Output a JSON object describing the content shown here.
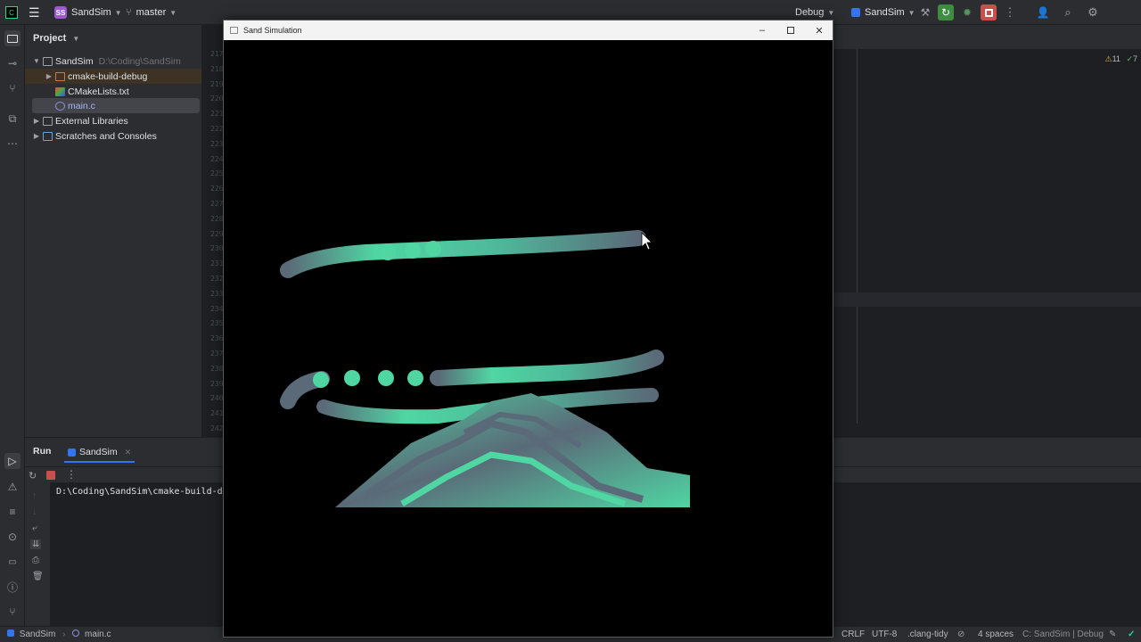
{
  "topbar": {
    "project_badge": "SS",
    "project_name": "SandSim",
    "branch": "master",
    "run_config": "Debug",
    "target": "SandSim"
  },
  "project_panel": {
    "title": "Project",
    "tree": [
      {
        "label": "SandSim",
        "path": "D:\\Coding\\SandSim"
      },
      {
        "label": "cmake-build-debug"
      },
      {
        "label": "CMakeLists.txt"
      },
      {
        "label": "main.c"
      },
      {
        "label": "External Libraries"
      },
      {
        "label": "Scratches and Consoles"
      }
    ]
  },
  "gutter_lines": [
    "217",
    "218",
    "219",
    "220",
    "221",
    "222",
    "223",
    "224",
    "225",
    "226",
    "227",
    "228",
    "229",
    "230",
    "231",
    "232",
    "233",
    "234",
    "235",
    "236",
    "237",
    "238",
    "239",
    "240",
    "241",
    "242",
    "243"
  ],
  "editor": {
    "inspections": "11",
    "warnings": "7"
  },
  "run_panel": {
    "title": "Run",
    "tab": "SandSim",
    "console_text": "D:\\Coding\\SandSim\\cmake-build-debu"
  },
  "sim_window": {
    "title": "Sand Simulation"
  },
  "status": {
    "breadcrumb_project": "SandSim",
    "breadcrumb_file": "main.c",
    "line_sep": "CRLF",
    "encoding": "UTF-8",
    "linter": ".clang-tidy",
    "indent": "4 spaces",
    "context": "C: SandSim | Debug"
  },
  "colors": {
    "accent": "#3574f0",
    "sand_teal": "#4fd6a3",
    "sand_gray": "#5a6a78"
  }
}
